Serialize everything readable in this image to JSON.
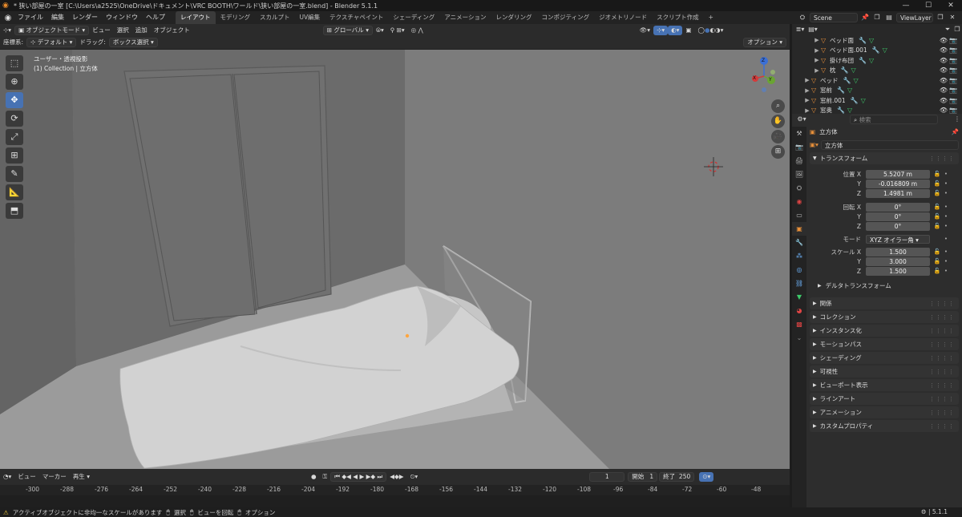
{
  "window": {
    "title": "* 狭い部屋の一室 [C:\\Users\\a2525\\OneDrive\\ドキュメント\\VRC BOOTH\\ワールド\\狭い部屋の一室.blend] - Blender 5.1.1",
    "controls": [
      "—",
      "☐",
      "✕"
    ]
  },
  "menu": [
    "ファイル",
    "編集",
    "レンダー",
    "ウィンドウ",
    "ヘルプ"
  ],
  "workspaces": [
    {
      "label": "レイアウト",
      "active": true
    },
    {
      "label": "モデリング"
    },
    {
      "label": "スカルプト"
    },
    {
      "label": "UV編集"
    },
    {
      "label": "テクスチャペイント"
    },
    {
      "label": "シェーディング"
    },
    {
      "label": "アニメーション"
    },
    {
      "label": "レンダリング"
    },
    {
      "label": "コンポジティング"
    },
    {
      "label": "ジオメトリノード"
    },
    {
      "label": "スクリプト作成"
    }
  ],
  "workspace_add": "+",
  "scene": {
    "name": "Scene",
    "view_layer": "ViewLayer"
  },
  "viewport": {
    "mode": "オブジェクトモード",
    "menus": [
      "ビュー",
      "選択",
      "追加",
      "オブジェクト"
    ],
    "orientation_label": "座標系:",
    "orientation": "デフォルト",
    "drag_label": "ドラッグ:",
    "drag": "ボックス選択",
    "transform_orientation": "グローバル",
    "options": "オプション",
    "info_line1": "ユーザー・透視投影",
    "info_line2": "(1) Collection | 立方体",
    "gizmo": {
      "x": "X",
      "y": "Y",
      "z": "Z"
    }
  },
  "outliner": {
    "rows": [
      {
        "name": "ベッド面",
        "indent": 2
      },
      {
        "name": "ベッド面.001",
        "indent": 2
      },
      {
        "name": "掛け布団",
        "indent": 2
      },
      {
        "name": "枕",
        "indent": 2
      },
      {
        "name": "ベッド",
        "indent": 1
      },
      {
        "name": "窓前",
        "indent": 1
      },
      {
        "name": "窓前.001",
        "indent": 1
      },
      {
        "name": "窓奥",
        "indent": 1
      }
    ]
  },
  "properties": {
    "search_placeholder": "検索",
    "object_name": "立方体",
    "object_datablock": "立方体",
    "transform_title": "トランスフォーム",
    "location_label": "位置 X",
    "location": [
      "5.5207 m",
      "-0.016809 m",
      "1.4981 m"
    ],
    "rotation_label": "回転 X",
    "rotation": [
      "0°",
      "0°",
      "0°"
    ],
    "mode_label": "モード",
    "rotation_mode": "XYZ オイラー角",
    "scale_label": "スケール X",
    "scale": [
      "1.500",
      "3.000",
      "1.500"
    ],
    "axis_y": "Y",
    "axis_z": "Z",
    "delta_transform": "デルタトランスフォーム",
    "sections": [
      "関係",
      "コレクション",
      "インスタンス化",
      "モーションパス",
      "シェーディング",
      "可視性",
      "ビューポート表示",
      "ラインアート",
      "アニメーション",
      "カスタムプロパティ"
    ]
  },
  "timeline": {
    "menus": [
      "ビュー",
      "マーカー",
      "再生"
    ],
    "current_frame": "1",
    "start_label": "開始",
    "start": "1",
    "end_label": "終了",
    "end": "250",
    "ruler": [
      "-300",
      "-288",
      "-276",
      "-264",
      "-252",
      "-240",
      "-228",
      "-216",
      "-204",
      "-192",
      "-180",
      "-168",
      "-156",
      "-144",
      "-132",
      "-120",
      "-108",
      "-96",
      "-84",
      "-72",
      "-60",
      "-48"
    ]
  },
  "status": {
    "warning": "アクティブオブジェクトに非均一なスケールがあります",
    "select": "選択",
    "rotate": "ビューを回転",
    "options": "オプション",
    "version": "5.1.1"
  },
  "colors": {
    "accent": "#4772b3",
    "object_orange": "#e8903a",
    "mesh_green": "#3ecb6b",
    "modifier_blue": "#6fb6ff",
    "viewport_bg": "#7a7a7a"
  }
}
